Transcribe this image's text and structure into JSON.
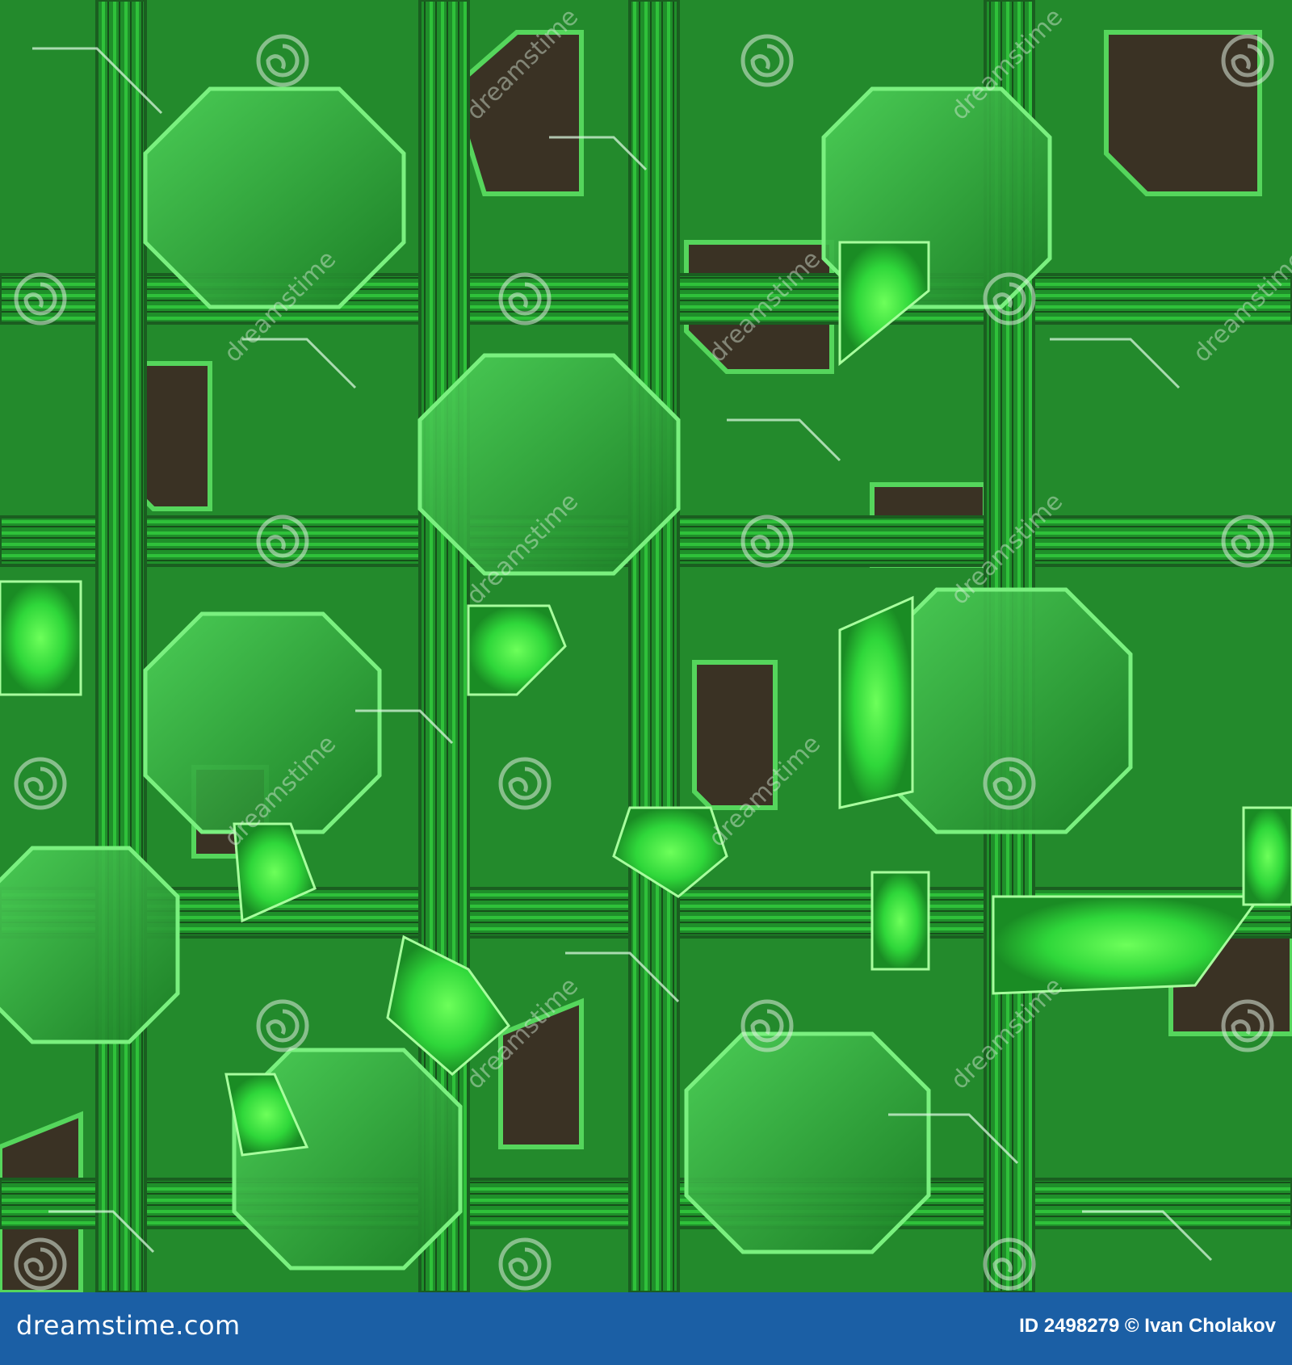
{
  "image": {
    "subject": "green glowing circuit board texture",
    "palette": {
      "bright_green": "#3ee53a",
      "mid_green": "#1f9a2a",
      "trace_green": "#2fc13a",
      "dark_substrate": "#3a3224",
      "highlight": "#cfe9d2",
      "footer_blue": "#1b5fa5"
    },
    "watermark": {
      "text": "dreamstime",
      "icon": "spiral-logo-icon"
    }
  },
  "footer": {
    "brand": "dreamstime.com",
    "id_label": "ID",
    "id_value": "2498279",
    "copyright_symbol": "©",
    "author": "Ivan Cholakov"
  }
}
